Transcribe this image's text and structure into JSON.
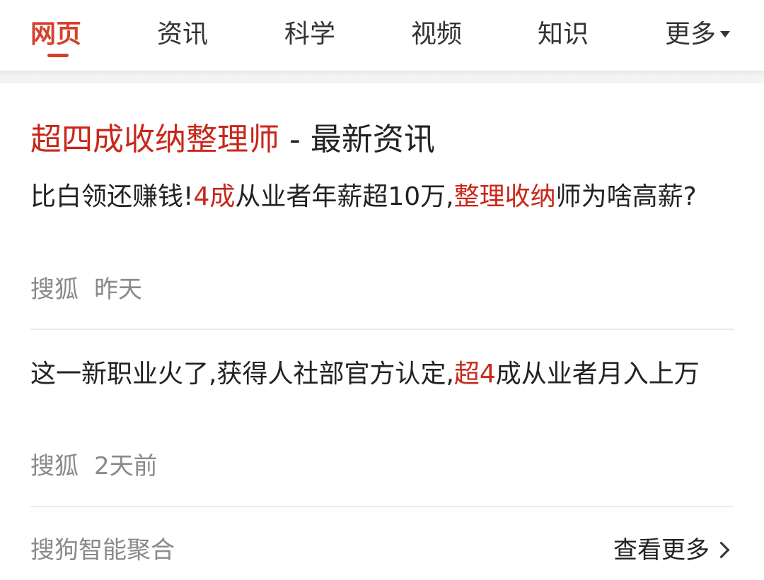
{
  "tabs": [
    {
      "label": "网页",
      "active": true
    },
    {
      "label": "资讯",
      "active": false
    },
    {
      "label": "科学",
      "active": false
    },
    {
      "label": "视频",
      "active": false
    },
    {
      "label": "知识",
      "active": false
    },
    {
      "label": "更多",
      "active": false
    }
  ],
  "card": {
    "title_highlight": "超四成收纳整理师",
    "title_rest": " - 最新资讯",
    "items": [
      {
        "segments": [
          {
            "text": "比白领还赚钱!",
            "highlight": false
          },
          {
            "text": "4成",
            "highlight": true
          },
          {
            "text": "从业者年薪超10万,",
            "highlight": false
          },
          {
            "text": "整理收纳",
            "highlight": true
          },
          {
            "text": "师为啥高薪?",
            "highlight": false
          }
        ],
        "source": "搜狐",
        "time": "昨天"
      },
      {
        "segments": [
          {
            "text": "这一新职业火了,获得人社部官方认定,",
            "highlight": false
          },
          {
            "text": "超4",
            "highlight": true
          },
          {
            "text": "成从业者月入上万",
            "highlight": false
          }
        ],
        "source": "搜狐",
        "time": "2天前"
      }
    ],
    "footer_label": "搜狗智能聚合",
    "view_more": "查看更多"
  },
  "colors": {
    "accent": "#d6402c",
    "highlight": "#c9271a",
    "meta_text": "#8a8a8a"
  }
}
